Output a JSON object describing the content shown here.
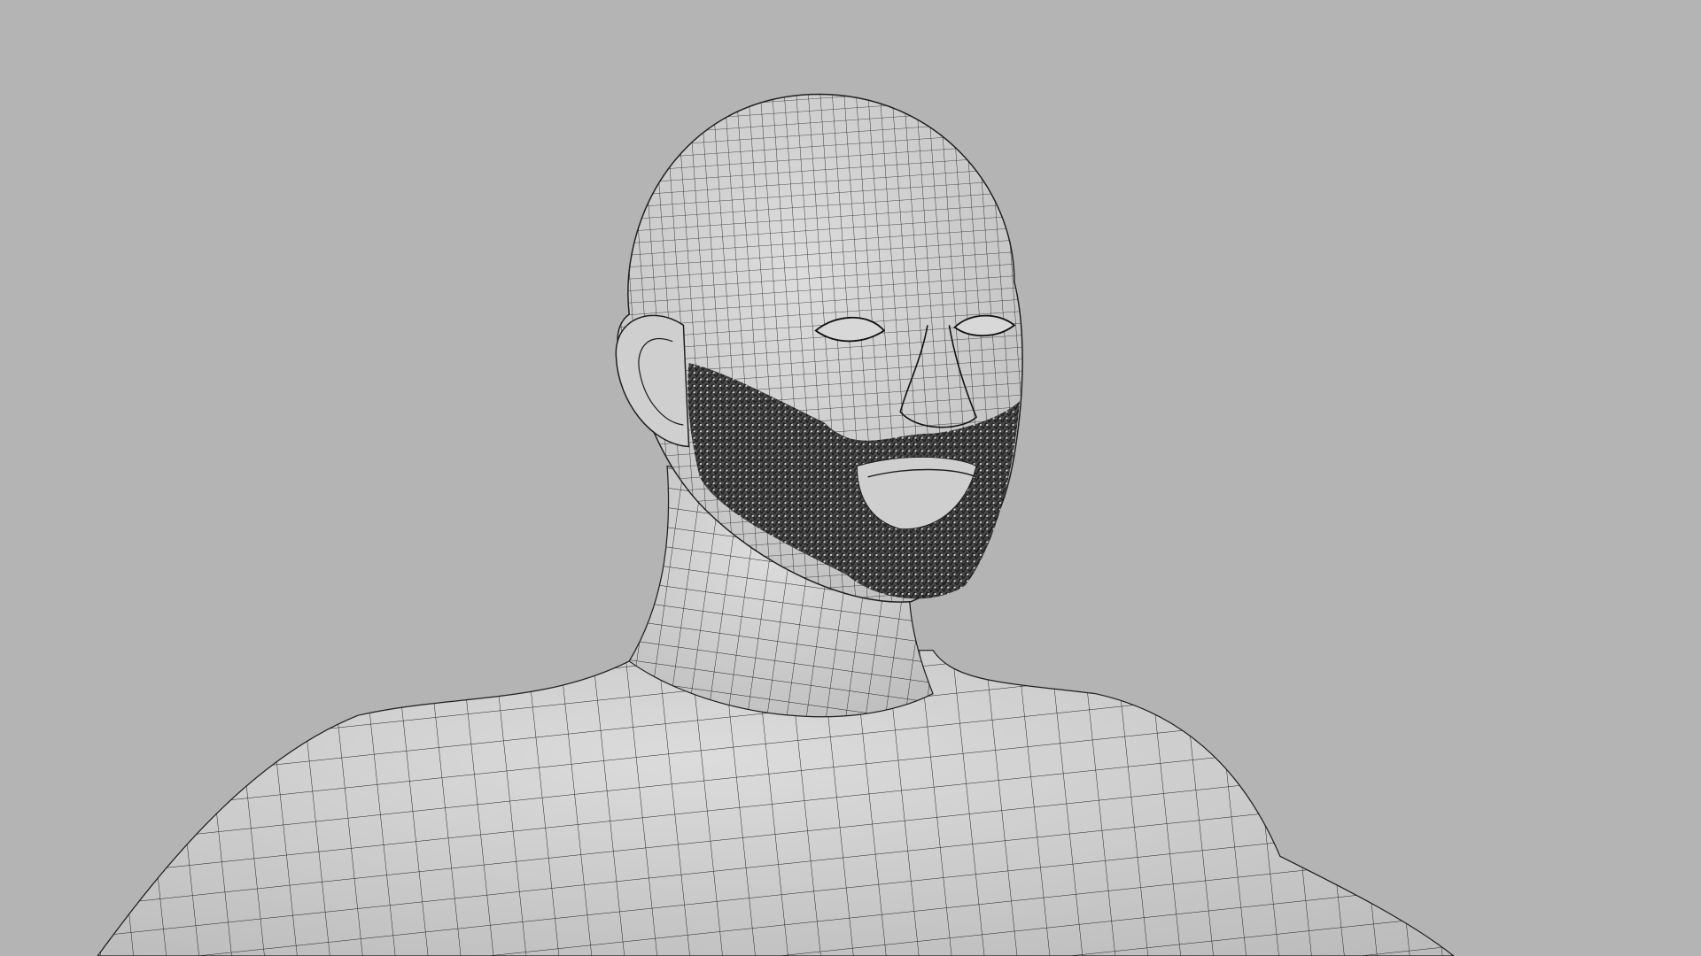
{
  "scene": {
    "background_color": "#b4b4b4",
    "mesh_color": "#d6d6d6",
    "mesh_shadow_color": "#bdbdbd",
    "wire_color": "#1e1e1e",
    "beard_color": "#151515"
  }
}
